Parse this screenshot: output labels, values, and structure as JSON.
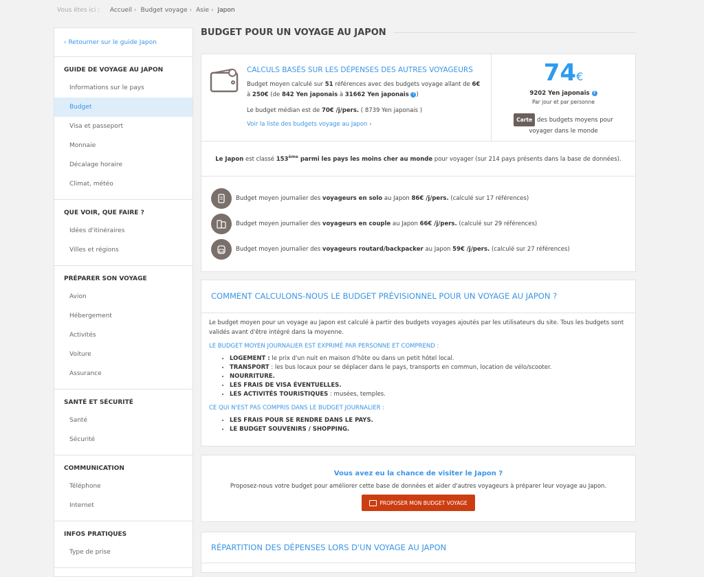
{
  "breadcrumb": {
    "label": "Vous êtes ici :",
    "items": [
      "Accueil",
      "Budget voyage",
      "Asie",
      "Japon"
    ]
  },
  "sidebar": {
    "back": "‹ Retourner sur le guide Japon",
    "sections": [
      {
        "title": "GUIDE DE VOYAGE AU JAPON",
        "items": [
          "Informations sur le pays",
          "Budget",
          "Visa et passeport",
          "Monnaie",
          "Décalage horaire",
          "Climat, météo"
        ]
      },
      {
        "title": "QUE VOIR, QUE FAIRE ?",
        "items": [
          "Idées d'itinéraires",
          "Villes et régions"
        ]
      },
      {
        "title": "PRÉPARER SON VOYAGE",
        "items": [
          "Avion",
          "Hébergement",
          "Activités",
          "Voiture",
          "Assurance"
        ]
      },
      {
        "title": "SANTÉ ET SÉCURITÉ",
        "items": [
          "Santé",
          "Sécurité"
        ]
      },
      {
        "title": "COMMUNICATION",
        "items": [
          "Téléphone",
          "Internet"
        ]
      },
      {
        "title": "INFOS PRATIQUES",
        "items": [
          "Type de prise"
        ]
      }
    ],
    "selected": "Budget"
  },
  "page_title": "BUDGET POUR UN VOYAGE AU JAPON",
  "summary": {
    "heading": "CALCULS BASÉS SUR LES DÉPENSES DES AUTRES VOYAGEURS",
    "t1": "Budget moyen calculé sur ",
    "refs": "51",
    "t2": " références avec des budgets voyage allant de ",
    "min": "6€",
    "t3": " à ",
    "max": "250€",
    "t4": " (de ",
    "min_yen": "842 Yen japonais",
    "t5": " à ",
    "max_yen": "31662 Yen japonais",
    "m1": "Le budget médian est de ",
    "median": "70€ /j/pers.",
    "m2": " ( 8739 Yen japonais )",
    "link": "Voir la liste des budgets voyage au Japon ›",
    "amount": "74",
    "currency": "€",
    "yen": "9202 Yen japonais",
    "per": "Par jour et par personne",
    "carte": "Carte",
    "carte_text": "des budgets moyens pour voyager dans le monde"
  },
  "ranking": {
    "country": "Le Japon",
    "t1": " est classé ",
    "rank": "153",
    "sup": "ème",
    "bold": " parmi les pays les moins cher au monde",
    "t2": " pour voyager (sur 214 pays présents dans la base de données)."
  },
  "travellers": [
    {
      "icon": "suitcase-icon",
      "pre": "Budget moyen journalier des ",
      "type": "voyageurs en solo",
      "mid": " au Japon ",
      "amount": "86€ /j/pers.",
      "post": " (calculé sur 17 références)"
    },
    {
      "icon": "two-suitcases-icon",
      "pre": "Budget moyen journalier des ",
      "type": "voyageurs en couple",
      "mid": " au Japon ",
      "amount": "66€ /j/pers.",
      "post": " (calculé sur 29 références)"
    },
    {
      "icon": "backpack-icon",
      "pre": "Budget moyen journalier des ",
      "type": "voyageurs routard/backpacker",
      "mid": " au Japon ",
      "amount": "59€ /j/pers.",
      "post": " (calculé sur 27 références)"
    }
  ],
  "method": {
    "heading": "COMMENT CALCULONS-NOUS LE BUDGET PRÉVISIONNEL POUR UN VOYAGE AU JAPON ?",
    "intro": "Le budget moyen pour un voyage au Japon est calculé à partir des budgets voyages ajoutés par les utilisateurs du site. Tous les budgets sont validés avant d'être intégré dans la moyenne.",
    "included_title": "LE BUDGET MOYEN JOURNALIER EST EXPRIMÉ PAR PERSONNE ET COMPREND :",
    "included": [
      {
        "b": "LOGEMENT :",
        "t": " le prix d'un nuit en maison d'hôte ou dans un petit hôtel local."
      },
      {
        "b": "TRANSPORT",
        "t": " : les bus locaux pour se déplacer dans le pays, transports en commun, location de vélo/scooter."
      },
      {
        "b": "NOURRITURE.",
        "t": ""
      },
      {
        "b": "LES FRAIS DE VISA ÉVENTUELLES.",
        "t": ""
      },
      {
        "b": "LES ACTIVITÉS TOURISTIQUES",
        "t": " : musées, temples."
      }
    ],
    "excluded_title": "CE QUI N'EST PAS COMPRIS DANS LE BUDGET JOURNALIER :",
    "excluded": [
      "LES FRAIS POUR SE RENDRE DANS LE PAYS.",
      "LE BUDGET SOUVENIRS / SHOPPING."
    ]
  },
  "cta": {
    "heading": "Vous avez eu la chance de visiter le Japon ?",
    "text": "Proposez-nous votre budget pour améliorer cette base de données et aider d'autres voyageurs à préparer leur voyage au Japon.",
    "button": "PROPOSER MON BUDGET VOYAGE",
    "button_color": "#cc3d12"
  },
  "repartition": {
    "heading": "RÉPARTITION DES DÉPENSES LORS D'UN VOYAGE AU JAPON"
  }
}
